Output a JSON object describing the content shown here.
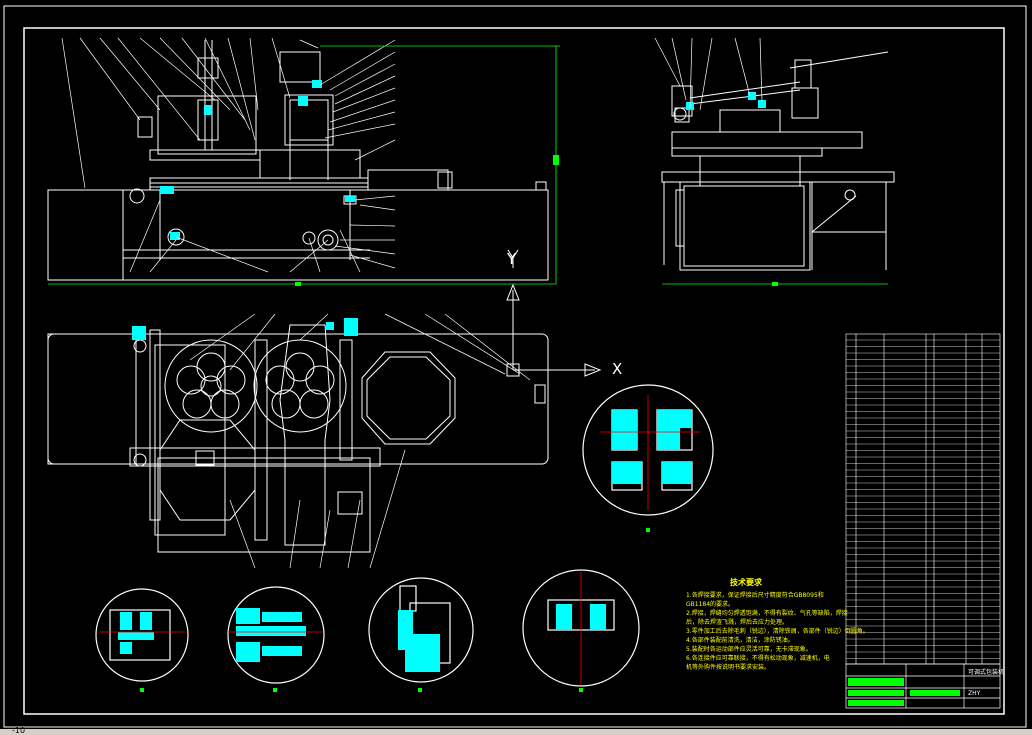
{
  "drawing": {
    "axis_x_label": "X",
    "axis_y_label": "Y",
    "technical_notes_title": "技术要求",
    "technical_notes": [
      "1.各焊接要求，保证焊接后尺寸精度符合GB8095和",
      "GB1184的要求。",
      "2.焊接，焊缝均匀焊透饱满，不得有裂纹、气孔等缺陷，焊接",
      "后，除去焊渣飞溅，焊后去应力处理。",
      "3.零件加工后去除毛刺（锐边），清除铁屑，各部件（锐边）倒圆角。",
      "4.各部件装配前清洗，清洁，涂防锈油。",
      "5.装配时各运动部件应灵活可靠，无卡滞现象。",
      "6.各连接件应可靠联接，不得有松动现象，减速机，电",
      "机等外购件按说明书要求安装。"
    ],
    "title_block": {
      "drawing_name": "可调式包装机",
      "drawing_number": "ZHY"
    },
    "status_coords": "-10"
  },
  "colors": {
    "background": "#000000",
    "lines": "#ffffff",
    "dimension": "#00ff00",
    "fill": "#00ffff",
    "centerline": "#ff0000",
    "text": "#ffff00"
  }
}
